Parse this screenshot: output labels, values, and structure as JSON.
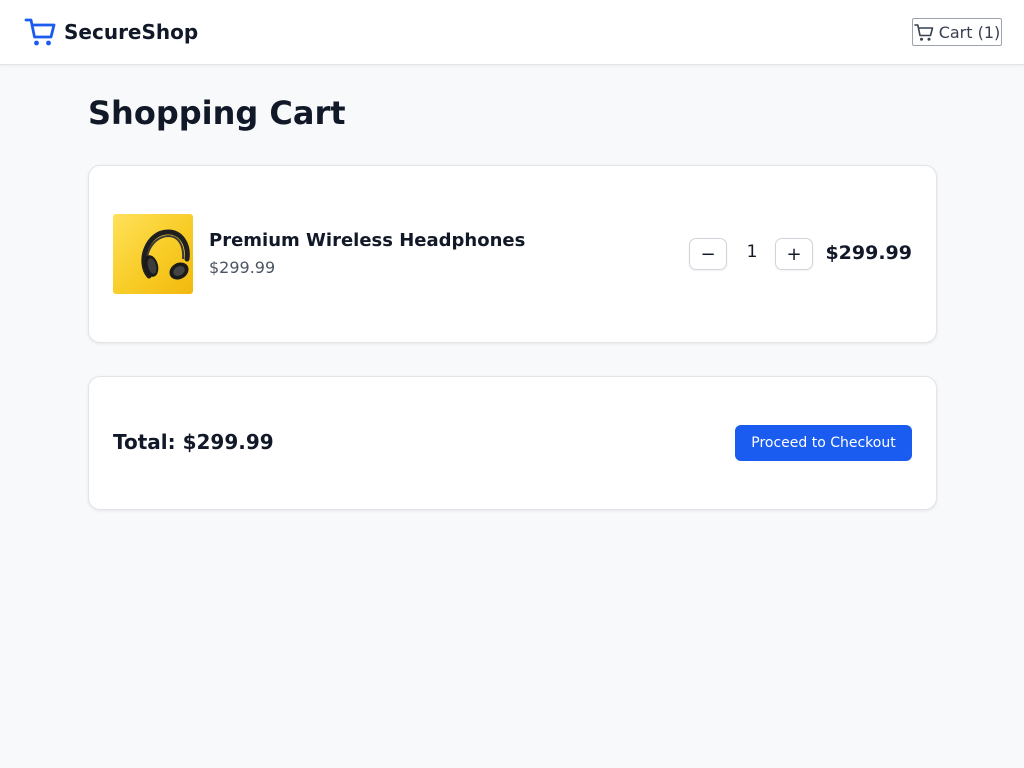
{
  "header": {
    "brand_name": "SecureShop",
    "brand_icon": "cart-icon",
    "cart_label": "Cart (1)",
    "cart_icon": "cart-icon"
  },
  "page": {
    "title": "Shopping Cart"
  },
  "cart": {
    "items": [
      {
        "name": "Premium Wireless Headphones",
        "unit_price": "$299.99",
        "quantity": "1",
        "line_total": "$299.99",
        "image": "headphones-on-yellow-background",
        "decrease_label": "−",
        "increase_label": "+"
      }
    ]
  },
  "summary": {
    "total_label": "Total: $299.99",
    "checkout_label": "Proceed to Checkout"
  },
  "colors": {
    "accent": "#1a5cf0",
    "page_background": "#f8f9fb",
    "card_background": "#ffffff",
    "text": "#111827",
    "muted_text": "#4b5563"
  }
}
